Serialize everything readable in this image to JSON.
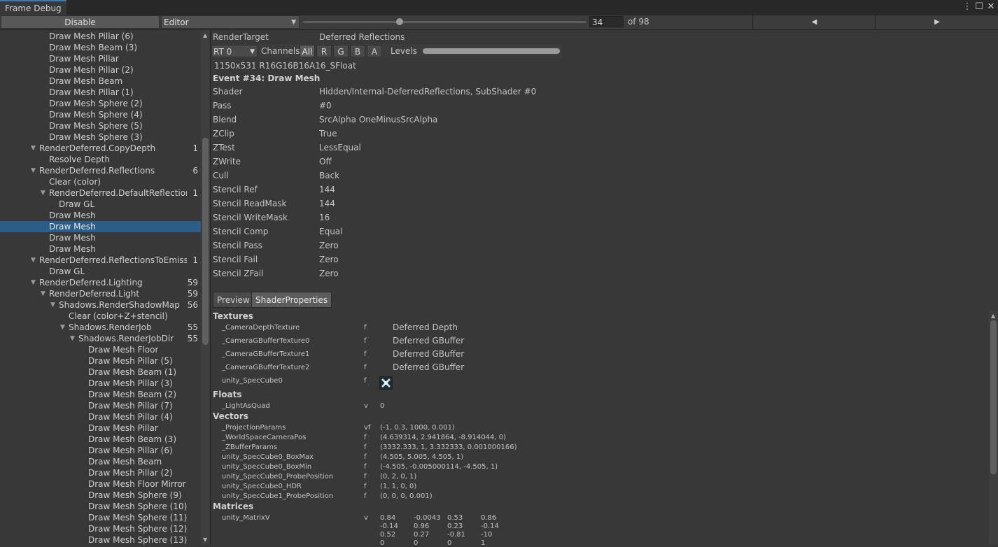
{
  "window": {
    "tab_title": "Frame Debug"
  },
  "toolbar": {
    "disable_label": "Disable",
    "target_select": "Editor",
    "frame_value": "34",
    "frame_total_label": "of 98",
    "prev_icon": "◀",
    "next_icon": "▶",
    "slider_fraction": 0.34
  },
  "tree": {
    "rows": [
      {
        "label": "Draw Mesh Pillar (6)",
        "depth": 5,
        "arrow": "",
        "count": ""
      },
      {
        "label": "Draw Mesh Beam (3)",
        "depth": 5,
        "arrow": "",
        "count": ""
      },
      {
        "label": "Draw Mesh Pillar",
        "depth": 5,
        "arrow": "",
        "count": ""
      },
      {
        "label": "Draw Mesh Pillar (2)",
        "depth": 5,
        "arrow": "",
        "count": ""
      },
      {
        "label": "Draw Mesh Beam",
        "depth": 5,
        "arrow": "",
        "count": ""
      },
      {
        "label": "Draw Mesh Pillar (1)",
        "depth": 5,
        "arrow": "",
        "count": ""
      },
      {
        "label": "Draw Mesh Sphere (2)",
        "depth": 5,
        "arrow": "",
        "count": ""
      },
      {
        "label": "Draw Mesh Sphere (4)",
        "depth": 5,
        "arrow": "",
        "count": ""
      },
      {
        "label": "Draw Mesh Sphere (5)",
        "depth": 5,
        "arrow": "",
        "count": ""
      },
      {
        "label": "Draw Mesh Sphere (3)",
        "depth": 5,
        "arrow": "",
        "count": ""
      },
      {
        "label": "RenderDeferred.CopyDepth",
        "depth": 4,
        "arrow": "▼",
        "count": "1"
      },
      {
        "label": "Resolve Depth",
        "depth": 5,
        "arrow": "",
        "count": ""
      },
      {
        "label": "RenderDeferred.Reflections",
        "depth": 4,
        "arrow": "▼",
        "count": "6"
      },
      {
        "label": "Clear (color)",
        "depth": 5,
        "arrow": "",
        "count": ""
      },
      {
        "label": "RenderDeferred.DefaultReflection",
        "depth": 5,
        "arrow": "▼",
        "count": "1"
      },
      {
        "label": "Draw GL",
        "depth": 6,
        "arrow": "",
        "count": ""
      },
      {
        "label": "Draw Mesh",
        "depth": 5,
        "arrow": "",
        "count": ""
      },
      {
        "label": "Draw Mesh",
        "depth": 5,
        "arrow": "",
        "count": "",
        "selected": true
      },
      {
        "label": "Draw Mesh",
        "depth": 5,
        "arrow": "",
        "count": ""
      },
      {
        "label": "Draw Mesh",
        "depth": 5,
        "arrow": "",
        "count": ""
      },
      {
        "label": "RenderDeferred.ReflectionsToEmissive",
        "depth": 4,
        "arrow": "▼",
        "count": "1"
      },
      {
        "label": "Draw GL",
        "depth": 5,
        "arrow": "",
        "count": ""
      },
      {
        "label": "RenderDeferred.Lighting",
        "depth": 4,
        "arrow": "▼",
        "count": "59"
      },
      {
        "label": "RenderDeferred.Light",
        "depth": 5,
        "arrow": "▼",
        "count": "59"
      },
      {
        "label": "Shadows.RenderShadowMap",
        "depth": 6,
        "arrow": "▼",
        "count": "56"
      },
      {
        "label": "Clear (color+Z+stencil)",
        "depth": 7,
        "arrow": "",
        "count": ""
      },
      {
        "label": "Shadows.RenderJob",
        "depth": 7,
        "arrow": "▼",
        "count": "55"
      },
      {
        "label": "Shadows.RenderJobDir",
        "depth": 8,
        "arrow": "▼",
        "count": "55"
      },
      {
        "label": "Draw Mesh Floor",
        "depth": 9,
        "arrow": "",
        "count": ""
      },
      {
        "label": "Draw Mesh Pillar (5)",
        "depth": 9,
        "arrow": "",
        "count": ""
      },
      {
        "label": "Draw Mesh Beam (1)",
        "depth": 9,
        "arrow": "",
        "count": ""
      },
      {
        "label": "Draw Mesh Pillar (3)",
        "depth": 9,
        "arrow": "",
        "count": ""
      },
      {
        "label": "Draw Mesh Beam (2)",
        "depth": 9,
        "arrow": "",
        "count": ""
      },
      {
        "label": "Draw Mesh Pillar (7)",
        "depth": 9,
        "arrow": "",
        "count": ""
      },
      {
        "label": "Draw Mesh Pillar (4)",
        "depth": 9,
        "arrow": "",
        "count": ""
      },
      {
        "label": "Draw Mesh Pillar",
        "depth": 9,
        "arrow": "",
        "count": ""
      },
      {
        "label": "Draw Mesh Beam (3)",
        "depth": 9,
        "arrow": "",
        "count": ""
      },
      {
        "label": "Draw Mesh Pillar (6)",
        "depth": 9,
        "arrow": "",
        "count": ""
      },
      {
        "label": "Draw Mesh Beam",
        "depth": 9,
        "arrow": "",
        "count": ""
      },
      {
        "label": "Draw Mesh Pillar (2)",
        "depth": 9,
        "arrow": "",
        "count": ""
      },
      {
        "label": "Draw Mesh Floor Mirror",
        "depth": 9,
        "arrow": "",
        "count": ""
      },
      {
        "label": "Draw Mesh Sphere (9)",
        "depth": 9,
        "arrow": "",
        "count": ""
      },
      {
        "label": "Draw Mesh Sphere (10)",
        "depth": 9,
        "arrow": "",
        "count": ""
      },
      {
        "label": "Draw Mesh Sphere (11)",
        "depth": 9,
        "arrow": "",
        "count": ""
      },
      {
        "label": "Draw Mesh Sphere (12)",
        "depth": 9,
        "arrow": "",
        "count": ""
      },
      {
        "label": "Draw Mesh Sphere (13)",
        "depth": 9,
        "arrow": "",
        "count": ""
      }
    ]
  },
  "render_target": {
    "label": "RenderTarget",
    "value": "Deferred Reflections",
    "rt_select": "RT 0",
    "channels_label": "Channels",
    "channels": [
      "All",
      "R",
      "G",
      "B",
      "A"
    ],
    "levels_label": "Levels",
    "format": "1150x531 R16G16B16A16_SFloat"
  },
  "event": {
    "title": "Event #34: Draw Mesh",
    "properties": [
      {
        "name": "Shader",
        "value": "Hidden/Internal-DeferredReflections, SubShader #0"
      },
      {
        "name": "Pass",
        "value": "#0"
      },
      {
        "name": "Blend",
        "value": "SrcAlpha OneMinusSrcAlpha"
      },
      {
        "name": "ZClip",
        "value": "True"
      },
      {
        "name": "ZTest",
        "value": "LessEqual"
      },
      {
        "name": "ZWrite",
        "value": "Off"
      },
      {
        "name": "Cull",
        "value": "Back"
      },
      {
        "name": "Stencil Ref",
        "value": "144"
      },
      {
        "name": "Stencil ReadMask",
        "value": "144"
      },
      {
        "name": "Stencil WriteMask",
        "value": "16"
      },
      {
        "name": "Stencil Comp",
        "value": "Equal"
      },
      {
        "name": "Stencil Pass",
        "value": "Zero"
      },
      {
        "name": "Stencil Fail",
        "value": "Zero"
      },
      {
        "name": "Stencil ZFail",
        "value": "Zero"
      }
    ]
  },
  "tabs": {
    "preview": "Preview",
    "shader_properties": "ShaderProperties"
  },
  "shader_props": {
    "textures_label": "Textures",
    "textures": [
      {
        "name": "_CameraDepthTexture",
        "type": "f",
        "value": "Deferred Depth"
      },
      {
        "name": "_CameraGBufferTexture0",
        "type": "f",
        "value": "Deferred GBuffer"
      },
      {
        "name": "_CameraGBufferTexture1",
        "type": "f",
        "value": "Deferred GBuffer"
      },
      {
        "name": "_CameraGBufferTexture2",
        "type": "f",
        "value": "Deferred GBuffer"
      },
      {
        "name": "unity_SpecCube0",
        "type": "f",
        "value": ""
      }
    ],
    "floats_label": "Floats",
    "floats": [
      {
        "name": "_LightAsQuad",
        "type": "v",
        "value": "0"
      }
    ],
    "vectors_label": "Vectors",
    "vectors": [
      {
        "name": "_ProjectionParams",
        "type": "vf",
        "value": "(-1, 0.3, 1000, 0.001)"
      },
      {
        "name": "_WorldSpaceCameraPos",
        "type": "f",
        "value": "(4.639314, 2.941864, -8.914044, 0)"
      },
      {
        "name": "_ZBufferParams",
        "type": "f",
        "value": "(3332.333, 1, 3.332333, 0.001000166)"
      },
      {
        "name": "unity_SpecCube0_BoxMax",
        "type": "f",
        "value": "(4.505, 5.005, 4.505, 1)"
      },
      {
        "name": "unity_SpecCube0_BoxMin",
        "type": "f",
        "value": "(-4.505, -0.005000114, -4.505, 1)"
      },
      {
        "name": "unity_SpecCube0_ProbePosition",
        "type": "f",
        "value": "(0, 2, 0, 1)"
      },
      {
        "name": "unity_SpecCube0_HDR",
        "type": "f",
        "value": "(1, 1, 0, 0)"
      },
      {
        "name": "unity_SpecCube1_ProbePosition",
        "type": "f",
        "value": "(0, 0, 0, 0.001)"
      }
    ],
    "matrices_label": "Matrices",
    "matrices": [
      {
        "name": "unity_MatrixV",
        "type": "v",
        "rows": [
          [
            "0.84",
            "-0.0043",
            "0.53",
            "0.86"
          ],
          [
            "-0.14",
            "0.96",
            "0.23",
            "-0.14"
          ],
          [
            "0.52",
            "0.27",
            "-0.81",
            "-10"
          ],
          [
            "0",
            "0",
            "0",
            "1"
          ]
        ]
      }
    ]
  },
  "colors": {
    "selection": "#2c5d87",
    "accent": "#3a79bb",
    "background": "#383838"
  }
}
